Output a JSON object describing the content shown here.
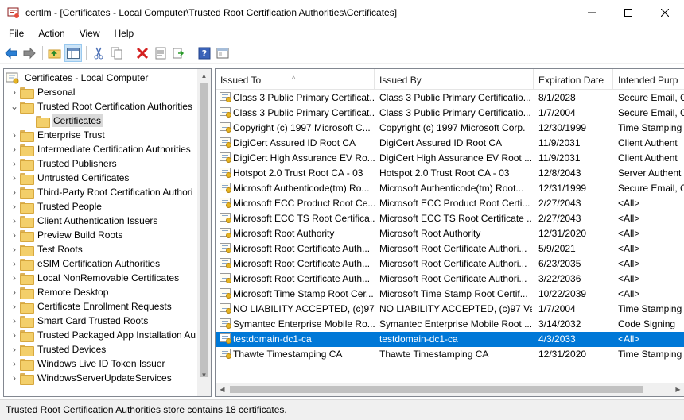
{
  "window": {
    "title": "certlm - [Certificates - Local Computer\\Trusted Root Certification Authorities\\Certificates]"
  },
  "menu": [
    "File",
    "Action",
    "View",
    "Help"
  ],
  "toolbar": {
    "icons": [
      "back-arrow-icon",
      "forward-arrow-icon",
      "up-folder-icon",
      "show-hide-tree-icon",
      "cut-icon",
      "copy-icon",
      "delete-icon",
      "properties-icon",
      "export-icon",
      "help-icon",
      "view-icon"
    ]
  },
  "tree": {
    "items": [
      {
        "label": "Certificates - Local Computer",
        "level": 0,
        "chevron": "",
        "icon": "certificate-store-icon"
      },
      {
        "label": "Personal",
        "level": 1,
        "chevron": "›"
      },
      {
        "label": "Trusted Root Certification Authorities",
        "level": 1,
        "chevron": "⌄"
      },
      {
        "label": "Certificates",
        "level": 2,
        "chevron": "",
        "selected": true
      },
      {
        "label": "Enterprise Trust",
        "level": 1,
        "chevron": "›"
      },
      {
        "label": "Intermediate Certification Authorities",
        "level": 1,
        "chevron": "›"
      },
      {
        "label": "Trusted Publishers",
        "level": 1,
        "chevron": "›"
      },
      {
        "label": "Untrusted Certificates",
        "level": 1,
        "chevron": "›"
      },
      {
        "label": "Third-Party Root Certification Authori",
        "level": 1,
        "chevron": "›"
      },
      {
        "label": "Trusted People",
        "level": 1,
        "chevron": "›"
      },
      {
        "label": "Client Authentication Issuers",
        "level": 1,
        "chevron": "›"
      },
      {
        "label": "Preview Build Roots",
        "level": 1,
        "chevron": "›"
      },
      {
        "label": "Test Roots",
        "level": 1,
        "chevron": "›"
      },
      {
        "label": "eSIM Certification Authorities",
        "level": 1,
        "chevron": "›"
      },
      {
        "label": "Local NonRemovable Certificates",
        "level": 1,
        "chevron": "›"
      },
      {
        "label": "Remote Desktop",
        "level": 1,
        "chevron": "›"
      },
      {
        "label": "Certificate Enrollment Requests",
        "level": 1,
        "chevron": "›"
      },
      {
        "label": "Smart Card Trusted Roots",
        "level": 1,
        "chevron": "›"
      },
      {
        "label": "Trusted Packaged App Installation Au",
        "level": 1,
        "chevron": "›"
      },
      {
        "label": "Trusted Devices",
        "level": 1,
        "chevron": "›"
      },
      {
        "label": "Windows Live ID Token Issuer",
        "level": 1,
        "chevron": "›"
      },
      {
        "label": "WindowsServerUpdateServices",
        "level": 1,
        "chevron": "›"
      }
    ]
  },
  "list": {
    "columns": [
      "Issued To",
      "Issued By",
      "Expiration Date",
      "Intended Purp"
    ],
    "rows": [
      [
        "Class 3 Public Primary Certificat...",
        "Class 3 Public Primary Certificatio...",
        "8/1/2028",
        "Secure Email, C"
      ],
      [
        "Class 3 Public Primary Certificat...",
        "Class 3 Public Primary Certificatio...",
        "1/7/2004",
        "Secure Email, C"
      ],
      [
        "Copyright (c) 1997 Microsoft C...",
        "Copyright (c) 1997 Microsoft Corp.",
        "12/30/1999",
        "Time Stamping"
      ],
      [
        "DigiCert Assured ID Root CA",
        "DigiCert Assured ID Root CA",
        "11/9/2031",
        "Client Authent"
      ],
      [
        "DigiCert High Assurance EV Ro...",
        "DigiCert High Assurance EV Root ...",
        "11/9/2031",
        "Client Authent"
      ],
      [
        "Hotspot 2.0 Trust Root CA - 03",
        "Hotspot 2.0 Trust Root CA - 03",
        "12/8/2043",
        "Server Authent"
      ],
      [
        "Microsoft Authenticode(tm) Ro...",
        "Microsoft Authenticode(tm) Root...",
        "12/31/1999",
        "Secure Email, C"
      ],
      [
        "Microsoft ECC Product Root Ce...",
        "Microsoft ECC Product Root Certi...",
        "2/27/2043",
        "<All>"
      ],
      [
        "Microsoft ECC TS Root Certifica...",
        "Microsoft ECC TS Root Certificate ...",
        "2/27/2043",
        "<All>"
      ],
      [
        "Microsoft Root Authority",
        "Microsoft Root Authority",
        "12/31/2020",
        "<All>"
      ],
      [
        "Microsoft Root Certificate Auth...",
        "Microsoft Root Certificate Authori...",
        "5/9/2021",
        "<All>"
      ],
      [
        "Microsoft Root Certificate Auth...",
        "Microsoft Root Certificate Authori...",
        "6/23/2035",
        "<All>"
      ],
      [
        "Microsoft Root Certificate Auth...",
        "Microsoft Root Certificate Authori...",
        "3/22/2036",
        "<All>"
      ],
      [
        "Microsoft Time Stamp Root Cer...",
        "Microsoft Time Stamp Root Certif...",
        "10/22/2039",
        "<All>"
      ],
      [
        "NO LIABILITY ACCEPTED, (c)97 ...",
        "NO LIABILITY ACCEPTED, (c)97 Ve...",
        "1/7/2004",
        "Time Stamping"
      ],
      [
        "Symantec Enterprise Mobile Ro...",
        "Symantec Enterprise Mobile Root ...",
        "3/14/2032",
        "Code Signing"
      ],
      [
        "testdomain-dc1-ca",
        "testdomain-dc1-ca",
        "4/3/2033",
        "<All>"
      ],
      [
        "Thawte Timestamping CA",
        "Thawte Timestamping CA",
        "12/31/2020",
        "Time Stamping"
      ]
    ],
    "selected_row": 16
  },
  "status": {
    "text": "Trusted Root Certification Authorities store contains 18 certificates."
  },
  "colors": {
    "selection": "#0078d7",
    "tree_selection": "#d9d9d9"
  }
}
